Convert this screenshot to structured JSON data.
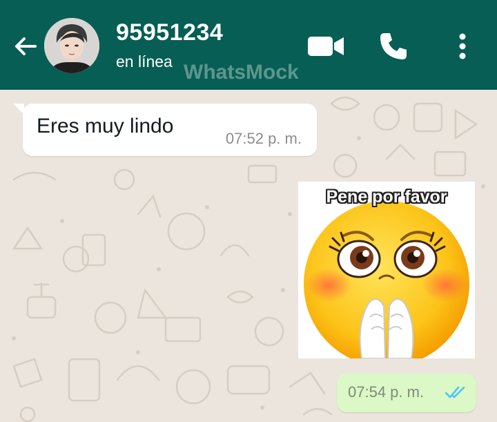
{
  "header": {
    "contact_name": "95951234",
    "status": "en línea",
    "watermark": "WhatsMock",
    "icons": {
      "back": "arrow-left-icon",
      "avatar": "avatar-photo",
      "video": "video-camera-icon",
      "call": "phone-icon",
      "menu": "more-vertical-icon"
    }
  },
  "chat": {
    "messages": [
      {
        "direction": "incoming",
        "type": "text",
        "text": "Eres muy lindo",
        "time": "07:52 p. m."
      },
      {
        "direction": "outgoing",
        "type": "sticker",
        "caption": "Pene por favor",
        "time": "07:54 p. m.",
        "status": "read",
        "status_icon": "double-check-icon"
      }
    ]
  },
  "colors": {
    "header": "#075e54",
    "chat_background": "#ece5dd",
    "incoming_bubble": "#ffffff",
    "outgoing_bubble": "#dcf8c6",
    "read_ticks": "#4fc3f7"
  }
}
